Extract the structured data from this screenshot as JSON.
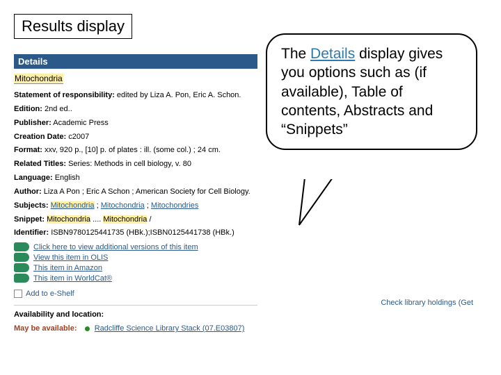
{
  "slide": {
    "title": "Results display"
  },
  "details": {
    "bar_label": "Details",
    "record_title": "Mitochondria",
    "fields": {
      "statement_label": "Statement of responsibility:",
      "statement_value": "edited by Liza A. Pon, Eric A. Schon.",
      "edition_label": "Edition:",
      "edition_value": "2nd ed..",
      "publisher_label": "Publisher:",
      "publisher_value": "Academic Press",
      "creation_label": "Creation Date:",
      "creation_value": "c2007",
      "format_label": "Format:",
      "format_value": "xxv, 920 p., [10] p. of plates : ill. (some col.) ; 24 cm.",
      "related_label": "Related Titles:",
      "related_value": "Series: Methods in cell biology, v. 80",
      "language_label": "Language:",
      "language_value": "English",
      "author_label": "Author:",
      "author_value": "Liza A Pon ; Eric A Schon ; American Society for Cell Biology.",
      "subjects_label": "Subjects:",
      "subjects_1": "Mitochondria",
      "subjects_2": "Mitochondria",
      "subjects_3": "Mitochondries",
      "snippet_label": "Snippet:",
      "snippet_1": "Mitochondria",
      "snippet_ellipsis": " .... ",
      "snippet_2": "Mitochondria",
      "snippet_end": " /",
      "identifier_label": "Identifier:",
      "identifier_value": "ISBN9780125441735 (HBk.);ISBN0125441738 (HBk.)"
    },
    "links": [
      {
        "label": "Click here to view additional versions of this item"
      },
      {
        "label": "View this item in OLIS"
      },
      {
        "label": "This item in Amazon"
      },
      {
        "label": "This item in WorldCat®"
      }
    ],
    "eshelf_label": "Add to e-Shelf",
    "availability_heading": "Availability and location:",
    "may_label": "May be available:",
    "location_label": "Radcliffe Science Library Stack (07.E03807)"
  },
  "check_holdings": "Check library holdings (Get",
  "bubble": {
    "t1": "The ",
    "t2": "Details",
    "t3": " display gives you options such as (if available), Table of contents, Abstracts and “Snippets”"
  }
}
